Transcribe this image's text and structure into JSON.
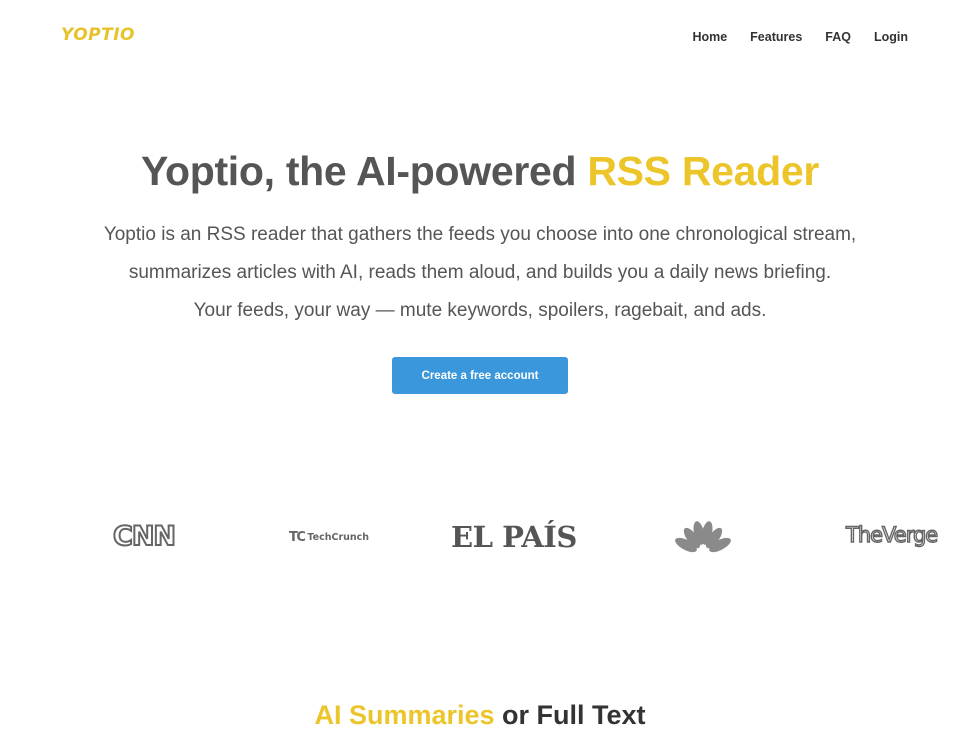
{
  "header": {
    "logo": "Yoptio",
    "nav": [
      {
        "label": "Home"
      },
      {
        "label": "Features"
      },
      {
        "label": "FAQ"
      },
      {
        "label": "Login"
      }
    ]
  },
  "hero": {
    "title_main": "Yoptio, the AI-powered ",
    "title_accent": "RSS Reader",
    "lines": [
      "Yoptio is an RSS reader that gathers the feeds you choose into one chronological stream,",
      "summarizes articles with AI, reads them aloud, and builds you a daily news briefing.",
      "Your feeds, your way — mute keywords, spoilers, ragebait, and ads."
    ],
    "cta_label": "Create a free account"
  },
  "press_logos": {
    "cnn": "CNN",
    "techcrunch_mark": "TC",
    "techcrunch": "TechCrunch",
    "elpais": "EL PAÍS",
    "nbc": "nbc-peacock-logo",
    "verge": "TheVerge"
  },
  "section": {
    "title_accent": "AI Summaries",
    "title_rest": " or Full Text"
  },
  "colors": {
    "accent": "#ecc52b",
    "button": "#3a97dc",
    "text": "#555555",
    "nav_text": "#333333"
  }
}
